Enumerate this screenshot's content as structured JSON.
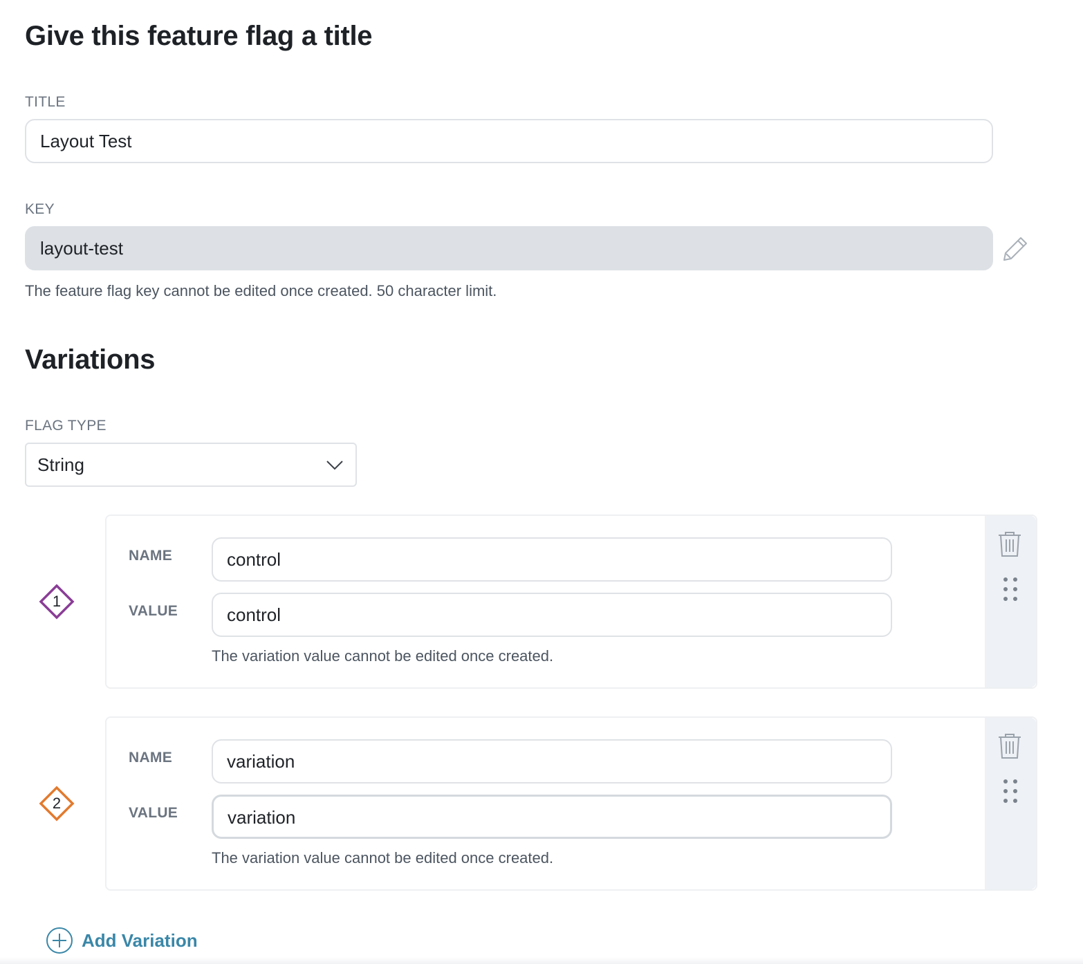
{
  "header": {
    "title": "Give this feature flag a title"
  },
  "title_field": {
    "label": "TITLE",
    "value": "Layout Test"
  },
  "key_field": {
    "label": "KEY",
    "value": "layout-test",
    "help": "The feature flag key cannot be edited once created. 50 character limit."
  },
  "variations_section": {
    "heading": "Variations",
    "flag_type": {
      "label": "FLAG TYPE",
      "selected": "String"
    },
    "variations": [
      {
        "index": "1",
        "color": "#8a3d96",
        "name_label": "NAME",
        "name": "control",
        "value_label": "VALUE",
        "value": "control",
        "help": "The variation value cannot be edited once created."
      },
      {
        "index": "2",
        "color": "#e27a2e",
        "name_label": "NAME",
        "name": "variation",
        "value_label": "VALUE",
        "value": "variation",
        "help": "The variation value cannot be edited once created."
      }
    ],
    "add_button": "Add Variation"
  },
  "colors": {
    "accent": "#3a87a8",
    "badge_1": "#8a3d96",
    "badge_2": "#e27a2e"
  },
  "icons": [
    "pencil-icon",
    "chevron-down-icon",
    "trash-icon",
    "drag-handle-icon",
    "plus-circle-icon"
  ]
}
